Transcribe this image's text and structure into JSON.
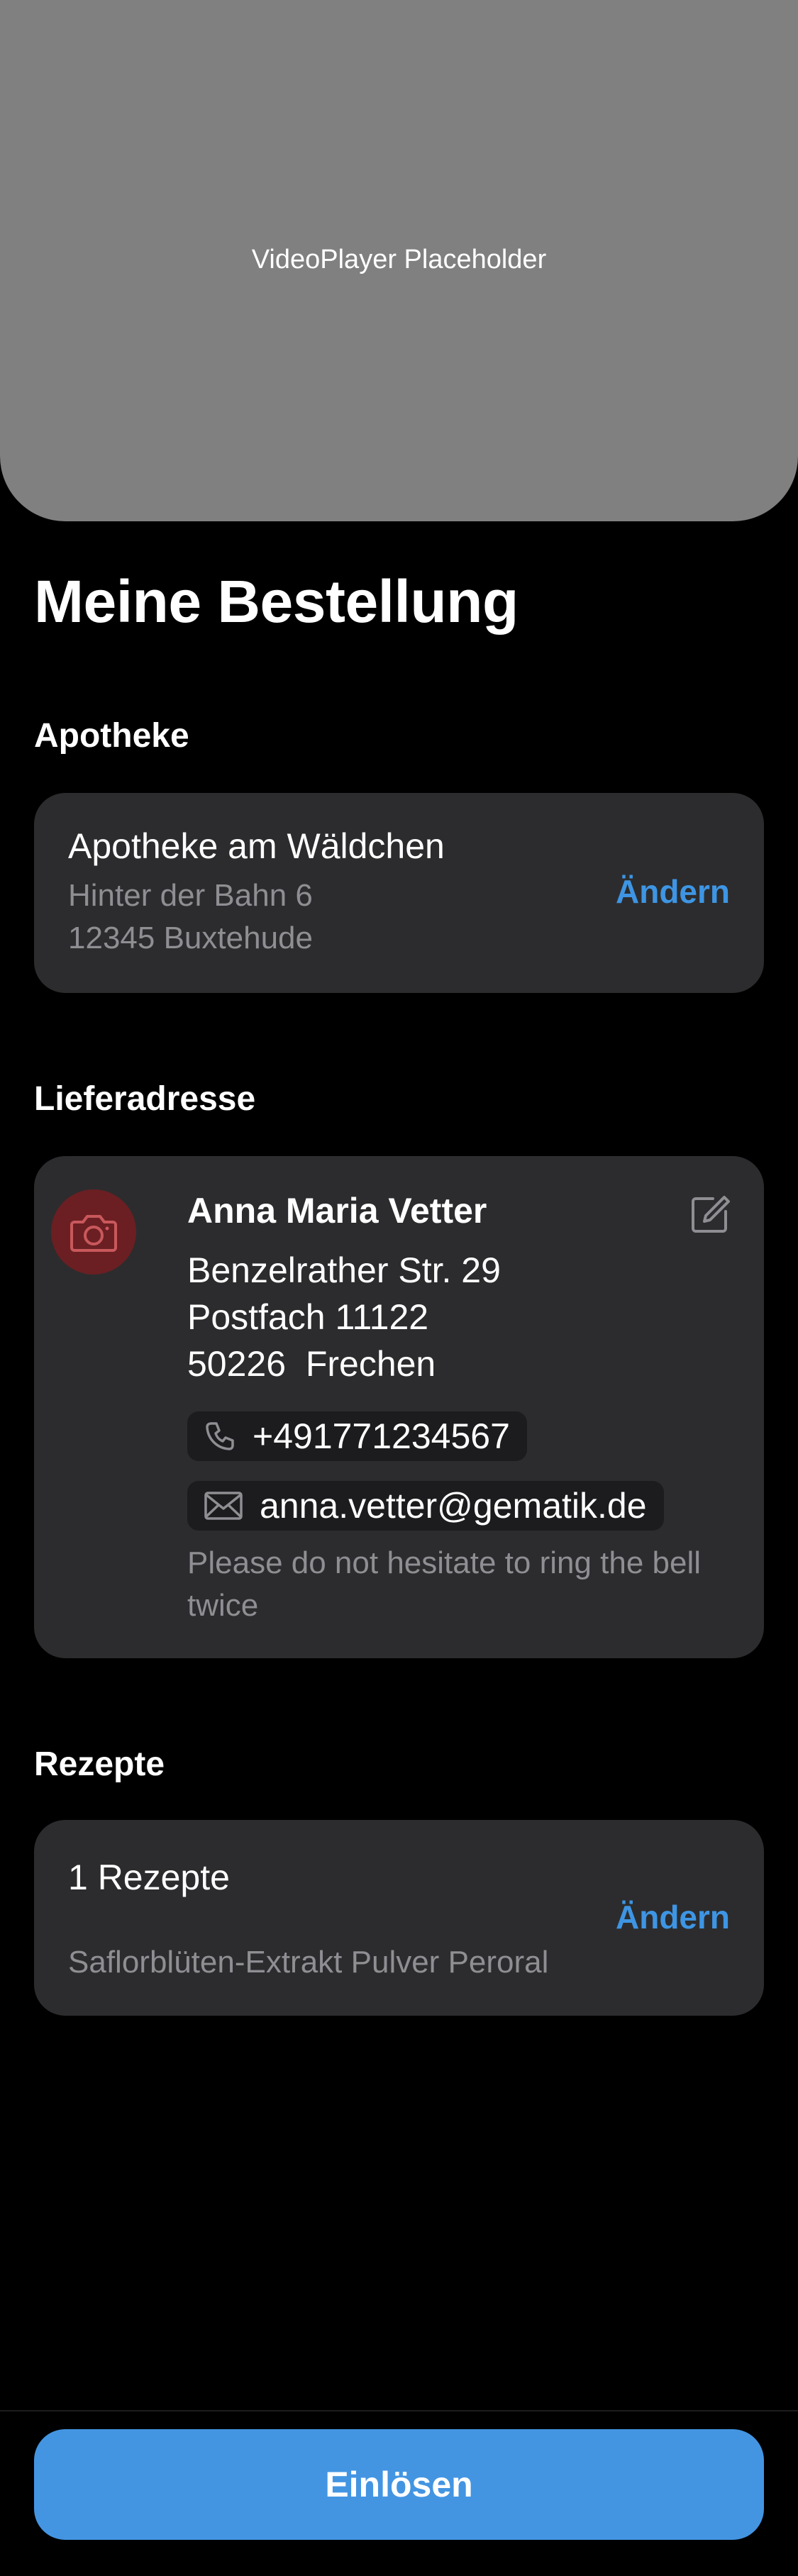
{
  "video": {
    "placeholder": "VideoPlayer Placeholder"
  },
  "page_title": "Meine Bestellung",
  "pharmacy": {
    "section_title": "Apotheke",
    "name": "Apotheke am Wäldchen",
    "street": "Hinter der Bahn 6",
    "city": "12345 Buxtehude",
    "change_label": "Ändern"
  },
  "delivery": {
    "section_title": "Lieferadresse",
    "avatar_icon": "camera-icon",
    "name": "Anna Maria Vetter",
    "street": "Benzelrather Str. 29",
    "postbox": "Postfach 11122",
    "city": "50226  Frechen",
    "phone": "+491771234567",
    "email": "anna.vetter@gematik.de",
    "note": "Please do not hesitate to ring the bell twice",
    "edit_icon": "edit-icon"
  },
  "prescriptions": {
    "section_title": "Rezepte",
    "count_label": "1 Rezepte",
    "item": "Saflorblüten-Extrakt Pulver Peroral",
    "change_label": "Ändern"
  },
  "footer": {
    "submit_label": "Einlösen"
  },
  "colors": {
    "accent": "#3e95e3",
    "button": "#4395e2",
    "card": "#2c2c2e",
    "avatar": "#6b1f22",
    "video_bg": "#808080"
  }
}
